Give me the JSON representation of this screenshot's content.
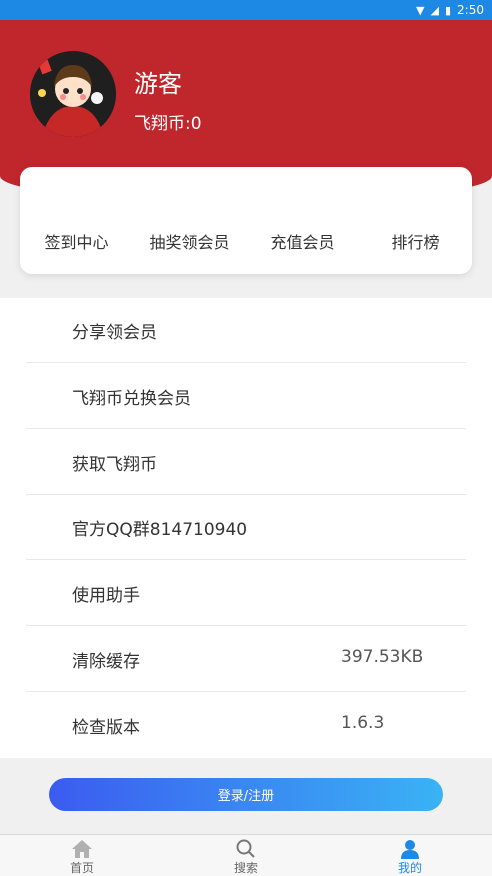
{
  "status_bar": {
    "time": "2:50"
  },
  "profile": {
    "name": "游客",
    "coins_text": "飞翔币:0"
  },
  "quick_actions": [
    {
      "label": "签到中心"
    },
    {
      "label": "抽奖领会员"
    },
    {
      "label": "充值会员"
    },
    {
      "label": "排行榜"
    }
  ],
  "menu": [
    {
      "label": "分享领会员",
      "value": ""
    },
    {
      "label": "飞翔币兑换会员",
      "value": ""
    },
    {
      "label": "获取飞翔币",
      "value": ""
    },
    {
      "label": "官方QQ群814710940",
      "value": ""
    },
    {
      "label": "使用助手",
      "value": ""
    },
    {
      "label": "清除缓存",
      "value": "397.53KB"
    },
    {
      "label": "检查版本",
      "value": "1.6.3"
    }
  ],
  "login_button": {
    "label": "登录/注册"
  },
  "tabs": [
    {
      "label": "首页",
      "icon": "home-icon",
      "active": false
    },
    {
      "label": "搜索",
      "icon": "search-icon",
      "active": false
    },
    {
      "label": "我的",
      "icon": "profile-icon",
      "active": true
    }
  ],
  "colors": {
    "header": "#c0272d",
    "accent": "#1e88e5",
    "button_start": "#3b5bf0",
    "button_end": "#3ab3f4"
  }
}
